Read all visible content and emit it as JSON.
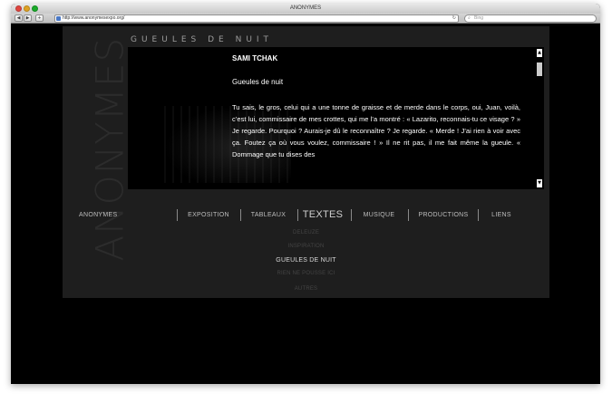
{
  "browser": {
    "window_title": "ANONYMES",
    "url": "http://www.anonymesexpo.org/",
    "search_placeholder": "Bing",
    "back_glyph": "◀",
    "forward_glyph": "▶",
    "add_glyph": "+",
    "reload_glyph": "↻",
    "search_glyph": "⌕"
  },
  "site": {
    "brand_vertical": "ANONYMES",
    "section_title": "GUEULES DE NUIT",
    "colors": {
      "background": "#000000",
      "panel": "#1e1e1e",
      "text": "#ffffff",
      "muted": "#444444"
    }
  },
  "article": {
    "author": "SAMI TCHAK",
    "title": "Gueules de nuit",
    "body": "Tu sais, le gros, celui qui a une tonne de graisse et de merde dans le corps, oui, Juan, voilà, c’est lui, commissaire de mes crottes, qui me l’a montré : « Lazarito, reconnais-tu ce visage ? » Je regarde. Pourquoi ? Aurais-je dû le reconnaître ? Je regarde. « Merde ! J’ai rien à voir avec ça. Foutez ça où vous voulez, commissaire ! » Il ne rit pas, il me fait même la gueule. « Dommage que tu dises des"
  },
  "scrollbar": {
    "up_glyph": "▲",
    "down_glyph": "▼",
    "position_fraction": 0.05
  },
  "nav": {
    "items": [
      {
        "label": "ANONYMES",
        "active": false
      },
      {
        "label": "EXPOSITION",
        "active": false
      },
      {
        "label": "TABLEAUX",
        "active": false
      },
      {
        "label": "TEXTES",
        "active": true
      },
      {
        "label": "MUSIQUE",
        "active": false
      },
      {
        "label": "PRODUCTIONS",
        "active": false
      },
      {
        "label": "LIENS",
        "active": false
      }
    ]
  },
  "subnav": {
    "items": [
      {
        "label": "DELEUZE",
        "active": false
      },
      {
        "label": "INSPIRATION",
        "active": false
      },
      {
        "label": "GUEULES DE NUIT",
        "active": true
      },
      {
        "label": "RIEN NE POUSSE ICI",
        "active": false
      },
      {
        "label": "AUTRES",
        "active": false
      }
    ]
  }
}
